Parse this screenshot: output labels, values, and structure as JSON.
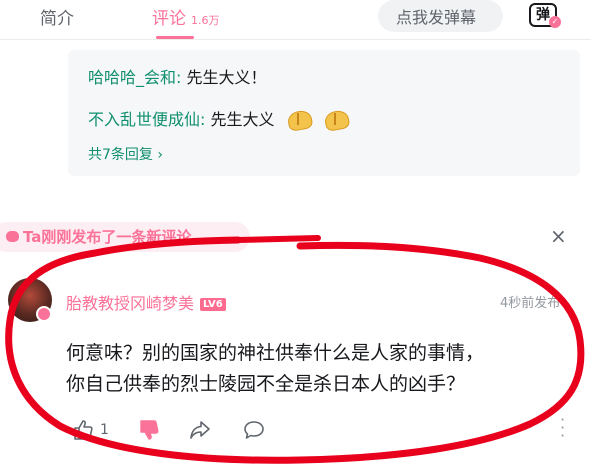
{
  "tabs": {
    "intro": "简介",
    "comments": "评论",
    "comments_count": "1.6万"
  },
  "danmaku": {
    "input_placeholder": "点我发弹幕",
    "toggle_glyph": "弹"
  },
  "replies": [
    {
      "name": "哈哈哈_会和",
      "text": "先生大义！"
    },
    {
      "name": "不入乱世便成仙",
      "text": "先生大义"
    }
  ],
  "replies_more": "共7条回复 ›",
  "banner": {
    "text": "Ta刚刚发布了一条新评论",
    "close": "×"
  },
  "comment": {
    "username": "胎教教授冈崎梦美",
    "level": "LV6",
    "time": "4秒前发布",
    "text_line1": "何意味？别的国家的神社供奉什么是人家的事情，",
    "text_line2": "你自己供奉的烈士陵园不全是杀日本人的凶手？",
    "likes": "1"
  },
  "colors": {
    "accent_pink": "#fb7299",
    "reply_name_green": "#0f8f6e",
    "annotation_red": "#e8001c"
  }
}
